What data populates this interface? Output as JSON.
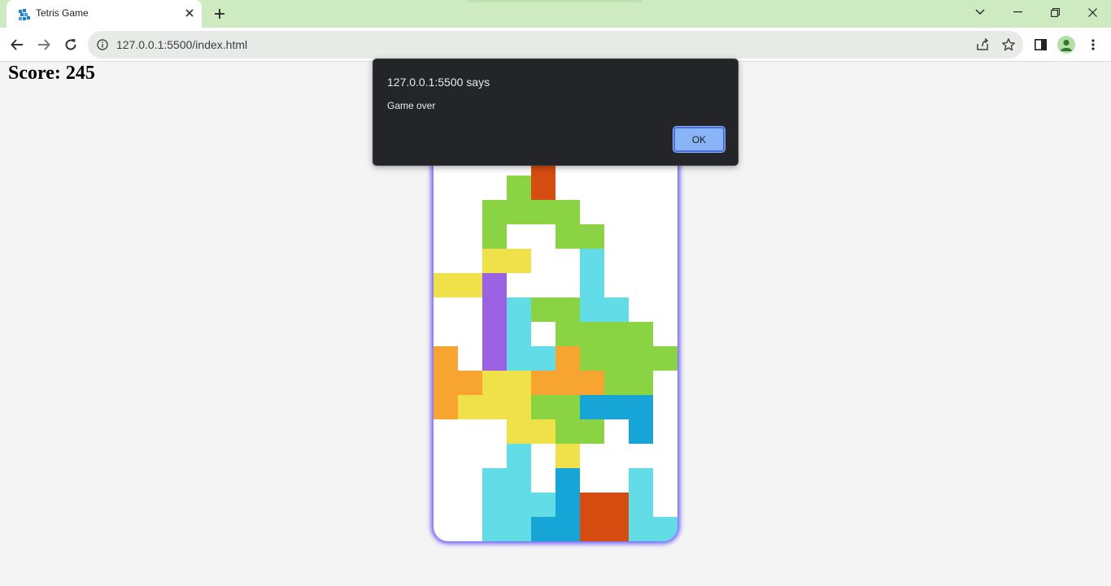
{
  "browser": {
    "tab": {
      "title": "Tetris Game",
      "favicon": "tetris-favicon-icon",
      "close_icon": "close-icon"
    },
    "new_tab_icon": "plus-icon",
    "window_controls": [
      "chevron-down-icon",
      "minimize-icon",
      "restore-icon",
      "close-icon"
    ],
    "toolbar": {
      "back_icon": "arrow-left-icon",
      "forward_icon": "arrow-right-icon",
      "reload_icon": "reload-icon",
      "site_info_icon": "info-icon",
      "url": "127.0.0.1:5500/index.html",
      "share_icon": "share-icon",
      "bookmark_icon": "star-icon",
      "side_panel_icon": "side-panel-icon",
      "profile_icon": "avatar-icon",
      "menu_icon": "kebab-menu-icon"
    },
    "colors": {
      "tabstrip": "#cdeac0",
      "omnibox": "#e8eae7"
    }
  },
  "page": {
    "score_label": "Score:",
    "score_value": "245"
  },
  "board": {
    "columns": 10,
    "rows": 19,
    "glow_color": "#6a5ff7",
    "palette": {
      "R": "#d64d11",
      "G": "#8ad444",
      "Y": "#f0e04a",
      "C": "#62dde8",
      "P": "#9b63e3",
      "O": "#f7a530",
      "B": "#17a4d6"
    },
    "grid": [
      "..........",
      "..........",
      "..........",
      "..........",
      "....R.....",
      "...GR.....",
      "..GGGG....",
      "..G..GG...",
      "..YY..C...",
      "YYP...C...",
      "..PCGGCC..",
      "..PC.GGGG.",
      "O.PCCOGGGG",
      "OOYYOOOGG.",
      "OYYYGGBBB.",
      "...YYGG.B.",
      "...C.Y....",
      "..CC.B..C.",
      "..CCCBRRC.",
      "..CCBBRRCC"
    ]
  },
  "dialog": {
    "title": "127.0.0.1:5500 says",
    "message": "Game over",
    "ok_label": "OK",
    "colors": {
      "background": "#242529",
      "button": "#8ab4f8"
    }
  }
}
